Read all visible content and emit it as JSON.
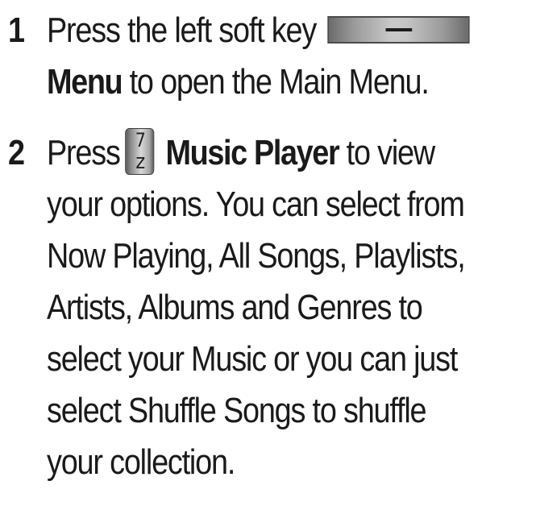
{
  "steps": [
    {
      "number": "1",
      "line1_text": "Press the left soft key",
      "soft_key_icon": "soft-key-dash-icon",
      "line2_bold": "Menu",
      "line2_text": " to open the Main Menu."
    },
    {
      "number": "2",
      "line1_text": "Press",
      "key_icon": "key-7-z-icon",
      "key_digit": "7",
      "key_letter": "z",
      "line1_bold": "Music Player",
      "line1_tail": " to view",
      "lines": [
        "your options. You can select from",
        "Now Playing, All Songs, Playlists,",
        "Artists, Albums and Genres to",
        "select your Music or you can just",
        "select Shuffle Songs to shuffle",
        "your collection."
      ]
    }
  ]
}
